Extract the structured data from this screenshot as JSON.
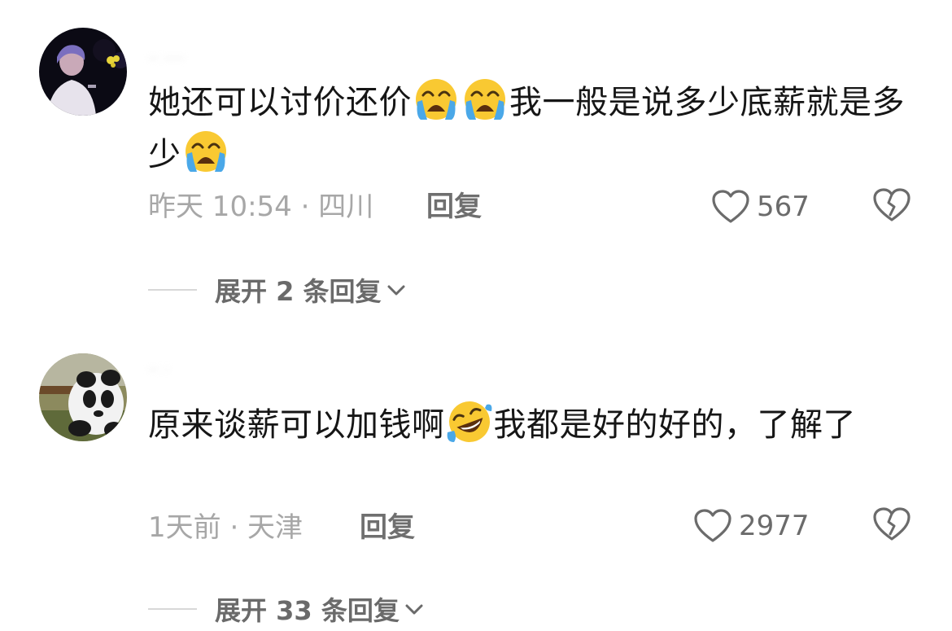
{
  "comments": [
    {
      "username": "·· ····",
      "text_before": "她还可以讨价还价",
      "text_after": "我一般是说多少底薪就是多少",
      "emoji_name": "loudly-crying-face",
      "time_location": "昨天 10:54 · 四川",
      "reply_label": "回复",
      "likes": "567",
      "expand_label": "展开 2 条回复"
    },
    {
      "username": "·· ·",
      "text_before": "原来谈薪可以加钱啊",
      "text_after": "我都是好的好的，了解了",
      "emoji_name": "rolling-on-the-floor-laughing",
      "time_location": "1天前 · 天津",
      "reply_label": "回复",
      "likes": "2977",
      "expand_label": "展开 33 条回复"
    }
  ],
  "colors": {
    "text_primary": "#161616",
    "text_meta": "#a7a7a7",
    "text_action": "#6f6f6f",
    "emoji_yellow": "#f9c932",
    "emoji_tear": "#4aa8e8"
  }
}
